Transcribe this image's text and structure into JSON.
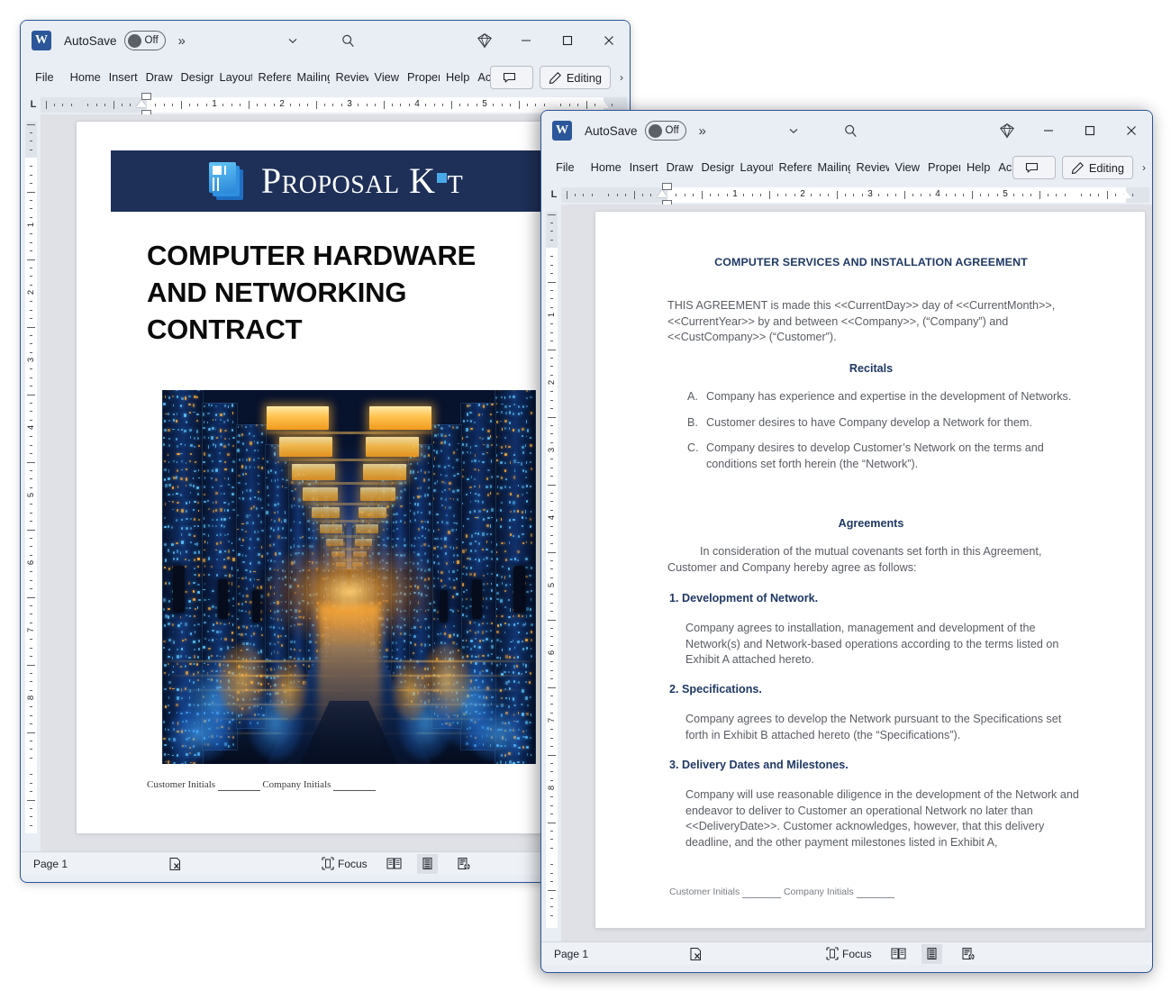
{
  "app": {
    "name": "Microsoft Word",
    "word_icon_letter": "W",
    "autosave_label": "AutoSave",
    "autosave_state": "Off",
    "overflow_glyph": "»",
    "ribbon_overflow_glyph": "›"
  },
  "ribbon": {
    "tabs": [
      {
        "label": "File"
      },
      {
        "label": "Home"
      },
      {
        "label": "Insert"
      },
      {
        "label": "Draw"
      },
      {
        "label": "Design"
      },
      {
        "label": "Layout"
      },
      {
        "label": "References"
      },
      {
        "label": "Mailings"
      },
      {
        "label": "Review"
      },
      {
        "label": "View"
      },
      {
        "label": "Properties"
      },
      {
        "label": "Help"
      },
      {
        "label": "Acrobat"
      }
    ],
    "comments_label": "",
    "editing_label": "Editing"
  },
  "ruler": {
    "left_tab_marker": "L",
    "numbers": [
      "1",
      "2",
      "3",
      "4",
      "5"
    ],
    "vertical_numbers": [
      "1",
      "2",
      "3",
      "4",
      "5",
      "6",
      "7",
      "8"
    ]
  },
  "statusbar": {
    "page_label": "Page 1",
    "focus_label": "Focus",
    "proofing_icon": "proofing-errors-icon",
    "views": [
      "read-mode-icon",
      "print-layout-icon",
      "web-layout-icon"
    ],
    "active_view": "print-layout-icon"
  },
  "window_back": {
    "title": "COMPUTER HARDWARE AND NETWORKING CONTRACT",
    "document": {
      "banner_brand": "Proposal Kit",
      "banner_color": "#1e3058",
      "title_lines": [
        "COMPUTER HARDWARE",
        "AND NETWORKING",
        "CONTRACT"
      ],
      "hero_image_alt": "data-center-server-aisle-photo",
      "footer": {
        "customer_label": "Customer Initials",
        "company_label": "Company Initials",
        "blank": "________"
      }
    }
  },
  "window_front": {
    "document": {
      "title": "COMPUTER SERVICES AND INSTALLATION AGREEMENT",
      "intro": "THIS AGREEMENT is made this <<CurrentDay>> day of <<CurrentMonth>>, <<CurrentYear>> by and between <<Company>>, (“Company”) and <<CustCompany>> (“Customer”).",
      "recitals_heading": "Recitals",
      "recitals": [
        {
          "marker": "A.",
          "text": "Company has experience and expertise in the development of Networks."
        },
        {
          "marker": "B.",
          "text": "Customer desires to have Company develop a Network for them."
        },
        {
          "marker": "C.",
          "text": "Company desires to develop Customer’s Network on the terms and conditions set forth herein (the “Network”)."
        }
      ],
      "agreements_heading": "Agreements",
      "agreements_intro": "In consideration of the mutual covenants set forth in this Agreement, Customer and Company hereby agree as follows:",
      "clauses": [
        {
          "heading": "1. Development of Network.",
          "body": "Company agrees to installation, management and development of  the Network(s) and Network-based operations according to the terms listed on Exhibit A attached hereto."
        },
        {
          "heading": "2. Specifications.",
          "body": "Company agrees to develop the Network pursuant to the Specifications set forth in Exhibit B attached hereto (the “Specifications”)."
        },
        {
          "heading": "3. Delivery Dates and Milestones.",
          "body": "Company will use reasonable diligence in the development of the Network and endeavor to deliver to Customer an operational Network no later than <<DeliveryDate>>.  Customer acknowledges, however, that this delivery deadline, and the other payment milestones listed in Exhibit A,"
        }
      ],
      "footer": {
        "customer_label": "Customer Initials",
        "company_label": "Company Initials",
        "blank": "_______"
      }
    }
  },
  "colors": {
    "accent_navy": "#1f3864",
    "banner_navy": "#1e3058",
    "word_blue": "#2b579a",
    "chrome": "#e9edf4",
    "canvas": "#dfe1e6"
  }
}
